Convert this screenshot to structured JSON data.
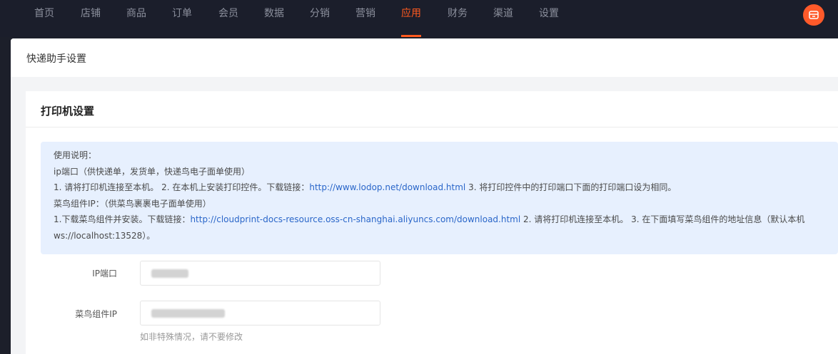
{
  "nav": {
    "items": [
      {
        "label": "首页"
      },
      {
        "label": "店铺"
      },
      {
        "label": "商品"
      },
      {
        "label": "订单"
      },
      {
        "label": "会员"
      },
      {
        "label": "数据"
      },
      {
        "label": "分销"
      },
      {
        "label": "营销"
      },
      {
        "label": "应用",
        "active": true
      },
      {
        "label": "财务"
      },
      {
        "label": "渠道"
      },
      {
        "label": "设置"
      }
    ],
    "avatar_icon": "store-icon",
    "accent_color": "#ff5a1f"
  },
  "page": {
    "title": "快递助手设置"
  },
  "printer_card": {
    "title": "打印机设置",
    "instructions": {
      "heading": "使用说明：",
      "ip_port_title": "ip端口（供快递单，发货单，快递鸟电子面单使用）",
      "ip_step1": "1. 请将打印机连接至本机。 2. 在本机上安装打印控件。下载链接：",
      "ip_link": "http://www.lodop.net/download.html",
      "ip_step3": " 3. 将打印控件中的打印端口下面的打印端口设为相同。",
      "cainiao_title": "菜鸟组件IP：（供菜鸟裹裹电子面单使用）",
      "cainiao_step1": "1.下载菜鸟组件并安装。下载链接：",
      "cainiao_link": "http://cloudprint-docs-resource.oss-cn-shanghai.aliyuncs.com/download.html",
      "cainiao_step2": " 2. 请将打印机连接至本机。 3. 在下面填写菜鸟组件的地址信息（默认本机",
      "cainiao_default": "ws://localhost:13528）。"
    },
    "fields": {
      "ip_port_label": "IP端口",
      "cainiao_ip_label": "菜鸟组件IP",
      "hint": "如非特殊情况，请不要修改"
    }
  }
}
